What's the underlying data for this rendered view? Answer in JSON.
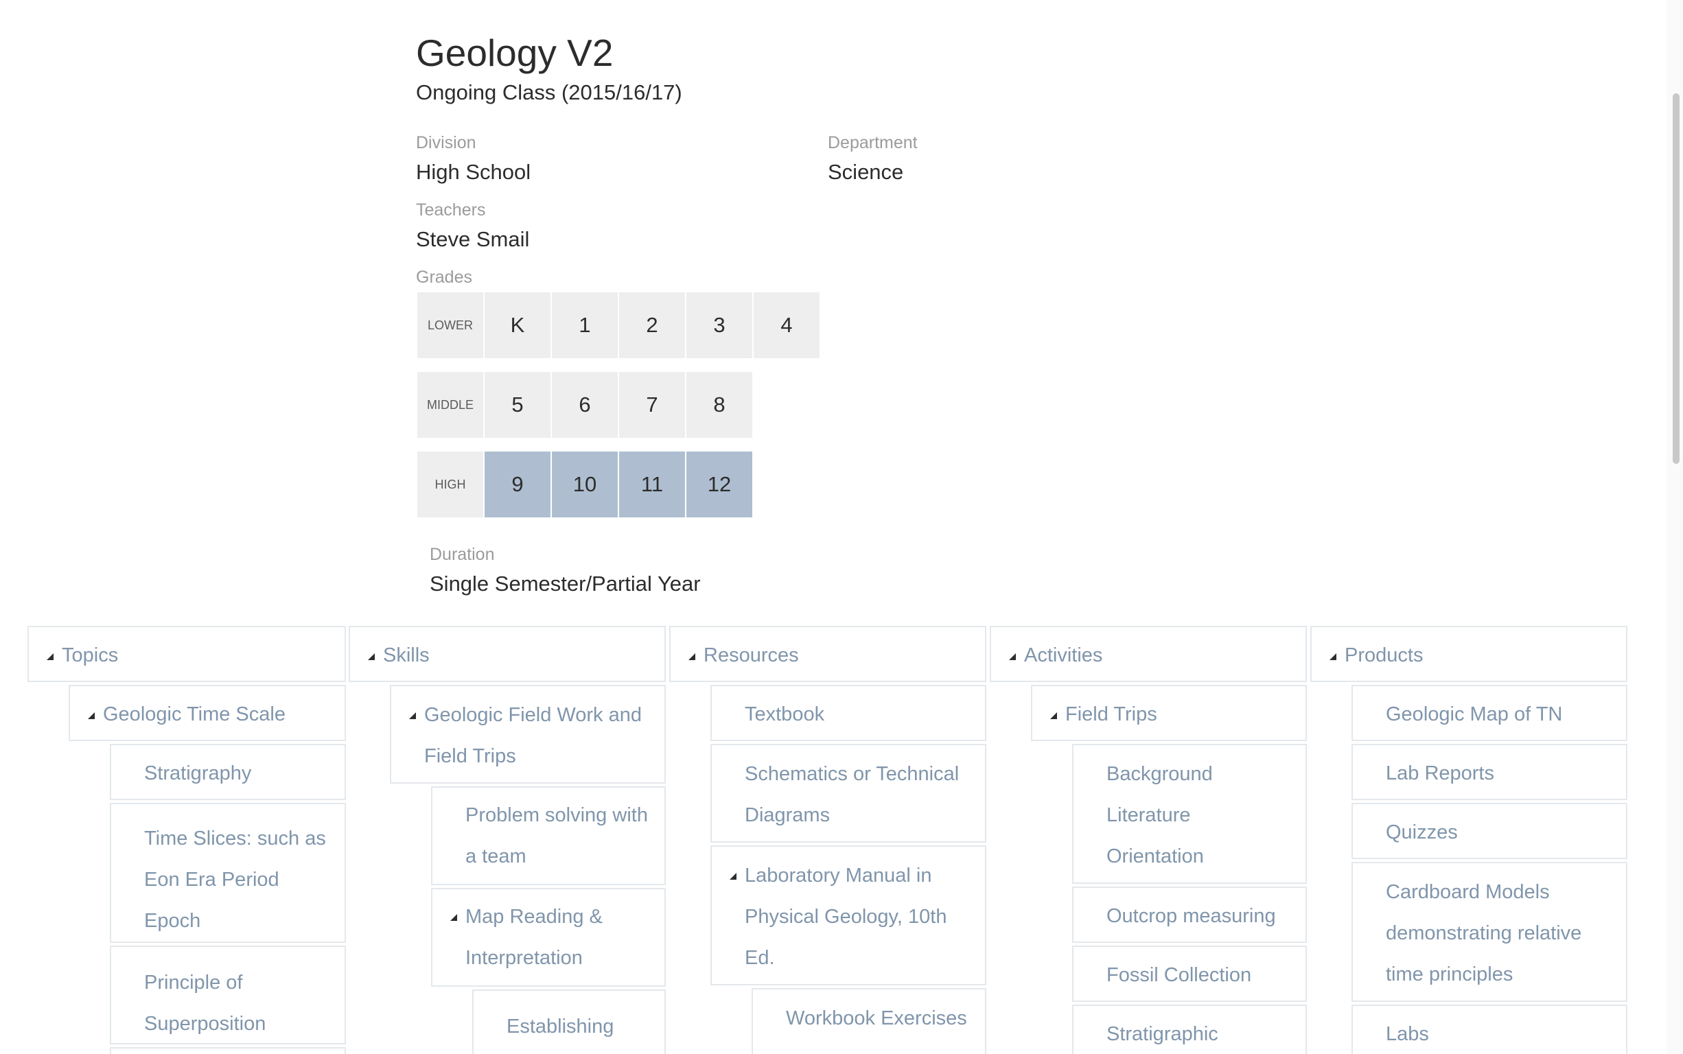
{
  "course": {
    "title": "Geology V2",
    "subtitle": "Ongoing Class (2015/16/17)",
    "division_label": "Division",
    "division_value": "High School",
    "department_label": "Department",
    "department_value": "Science",
    "teachers_label": "Teachers",
    "teachers_value": "Steve Smail",
    "grades_label": "Grades",
    "duration_label": "Duration",
    "duration_value": "Single Semester/Partial Year"
  },
  "grades": {
    "rows": [
      {
        "name": "LOWER",
        "cells": [
          "K",
          "1",
          "2",
          "3",
          "4"
        ],
        "selected": [
          false,
          false,
          false,
          false,
          false
        ]
      },
      {
        "name": "MIDDLE",
        "cells": [
          "5",
          "6",
          "7",
          "8"
        ],
        "selected": [
          false,
          false,
          false,
          false
        ]
      },
      {
        "name": "HIGH",
        "cells": [
          "9",
          "10",
          "11",
          "12"
        ],
        "selected": [
          true,
          true,
          true,
          true
        ]
      }
    ],
    "selected_color": "#aebed0",
    "unselected_color": "#eeeeee"
  },
  "tree": {
    "link_color": "#8095ab",
    "columns": [
      {
        "header": "Topics",
        "items": [
          {
            "label": "Geologic Time Scale"
          },
          {
            "label": "Stratigraphy"
          },
          {
            "label": "Time Slices: such as Eon Era Period Epoch"
          },
          {
            "label": "Principle of Superposition"
          }
        ]
      },
      {
        "header": "Skills",
        "items": [
          {
            "label": "Geologic Field Work and Field Trips"
          },
          {
            "label": "Problem solving with a team"
          },
          {
            "label": "Map Reading & Interpretation"
          },
          {
            "label": "Establishing Proportional"
          }
        ]
      },
      {
        "header": "Resources",
        "items": [
          {
            "label": "Textbook"
          },
          {
            "label": "Schematics or Technical Diagrams"
          },
          {
            "label": "Laboratory Manual in Physical Geology, 10th Ed."
          },
          {
            "label": "Workbook Exercises"
          }
        ]
      },
      {
        "header": "Activities",
        "items": [
          {
            "label": "Field Trips"
          },
          {
            "label": "Background Literature Orientation"
          },
          {
            "label": "Outcrop measuring"
          },
          {
            "label": "Fossil Collection"
          },
          {
            "label": "Stratigraphic"
          }
        ]
      },
      {
        "header": "Products",
        "items": [
          {
            "label": "Geologic Map of TN"
          },
          {
            "label": "Lab Reports"
          },
          {
            "label": "Quizzes"
          },
          {
            "label": "Cardboard Models demonstrating relative time principles"
          },
          {
            "label": "Labs"
          }
        ]
      }
    ]
  }
}
